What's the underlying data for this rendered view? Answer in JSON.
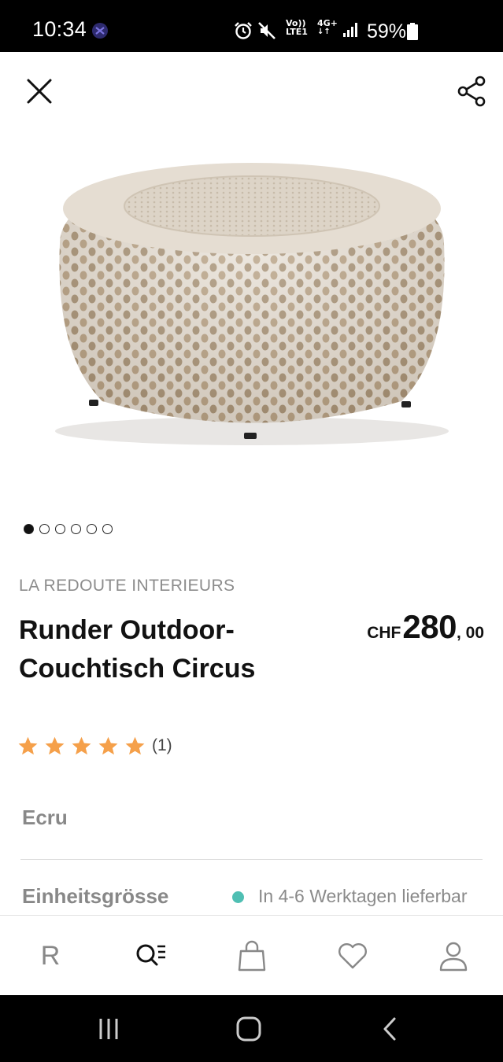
{
  "status_bar": {
    "time": "10:34",
    "network_top": "Vo)) 4G+",
    "network_label_1": "Vo))",
    "network_sub_1": "LTE1",
    "network_label_2": "4G+",
    "battery": "59%"
  },
  "top_bar": {
    "close_icon": "close-icon",
    "share_icon": "share-icon"
  },
  "gallery": {
    "image_count": 6,
    "active_index": 0
  },
  "product": {
    "brand": "LA REDOUTE INTERIEURS",
    "title": "Runder Outdoor-Couchtisch Circus",
    "price_currency": "CHF",
    "price_integer": "280",
    "price_decimal": ", 00",
    "rating_stars": 5,
    "rating_count": "(1)",
    "star_color": "#f5a04a"
  },
  "options": {
    "color": "Ecru",
    "size_label": "Einheitsgrösse",
    "availability": "In 4-6 Werktagen lieferbar",
    "availability_color": "#4fbfb3"
  },
  "bottom_nav": {
    "home_label": "R",
    "items": [
      "home",
      "search-menu-icon",
      "bag-icon",
      "heart-icon",
      "user-icon"
    ]
  },
  "system_nav": {
    "items": [
      "recents-icon",
      "home-icon",
      "back-icon"
    ]
  }
}
